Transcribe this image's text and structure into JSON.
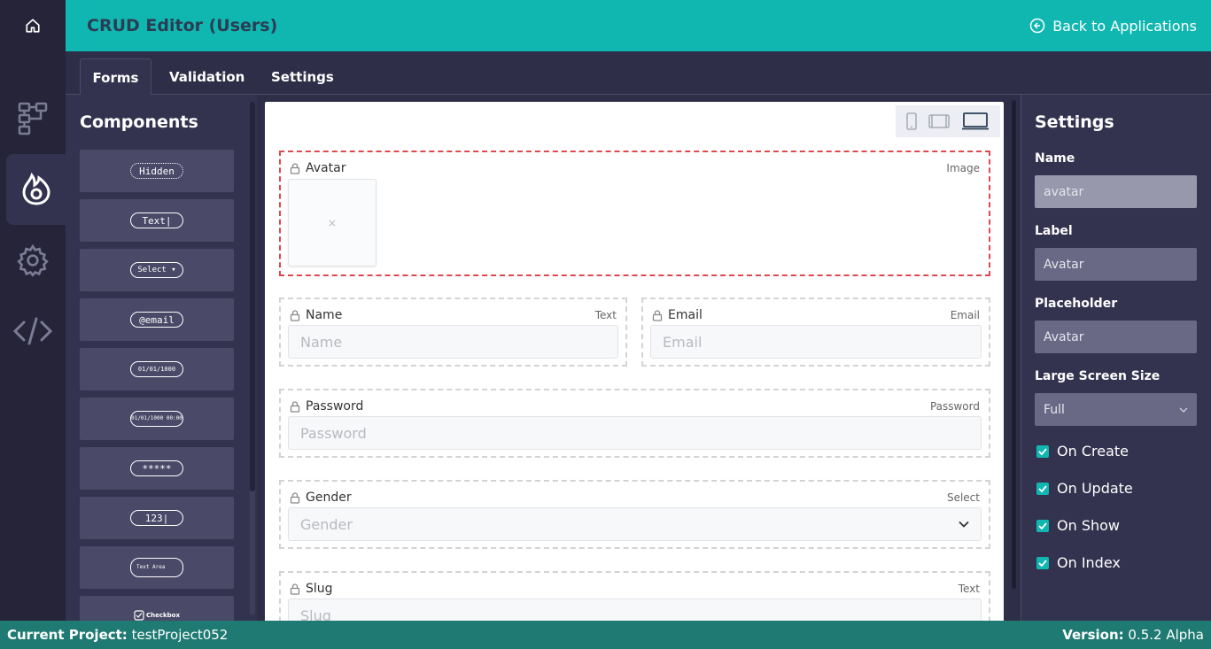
{
  "header": {
    "title": "CRUD Editor (Users)",
    "back_label": "Back to Applications"
  },
  "tabs": [
    {
      "label": "Forms",
      "active": true
    },
    {
      "label": "Validation",
      "active": false
    },
    {
      "label": "Settings",
      "active": false
    }
  ],
  "rail": [
    "home-icon",
    "sitemap-icon",
    "fire-icon",
    "gear-icon",
    "code-icon"
  ],
  "components": {
    "title": "Components",
    "items": [
      {
        "label": "Hidden"
      },
      {
        "label": "Text|"
      },
      {
        "label": "Select ▾"
      },
      {
        "label": "@email"
      },
      {
        "label": "01/01/1000"
      },
      {
        "label": "01/01/1000 00:00"
      },
      {
        "label": "*****"
      },
      {
        "label": "123|"
      },
      {
        "label": "Text Area"
      },
      {
        "label": "Checkbox"
      }
    ]
  },
  "form": {
    "fields": [
      {
        "label": "Avatar",
        "type": "Image"
      },
      {
        "label": "Name",
        "type": "Text",
        "placeholder": "Name"
      },
      {
        "label": "Email",
        "type": "Email",
        "placeholder": "Email"
      },
      {
        "label": "Password",
        "type": "Password",
        "placeholder": "Password"
      },
      {
        "label": "Gender",
        "type": "Select",
        "placeholder": "Gender"
      },
      {
        "label": "Slug",
        "type": "Text",
        "placeholder": "Slug"
      }
    ],
    "image_placeholder": "×"
  },
  "settings": {
    "title": "Settings",
    "name_label": "Name",
    "name_value": "avatar",
    "label_label": "Label",
    "label_value": "Avatar",
    "placeholder_label": "Placeholder",
    "placeholder_value": "Avatar",
    "size_label": "Large Screen Size",
    "size_value": "Full",
    "checks": [
      {
        "label": "On Create",
        "checked": true
      },
      {
        "label": "On Update",
        "checked": true
      },
      {
        "label": "On Show",
        "checked": true
      },
      {
        "label": "On Index",
        "checked": true
      }
    ]
  },
  "footer": {
    "project_label": "Current Project:",
    "project_value": "testProject052",
    "version_label": "Version:",
    "version_value": "0.5.2 Alpha"
  },
  "colors": {
    "accent": "#10b7b0",
    "footer": "#1e7a72",
    "selected_border": "#e0484f"
  }
}
